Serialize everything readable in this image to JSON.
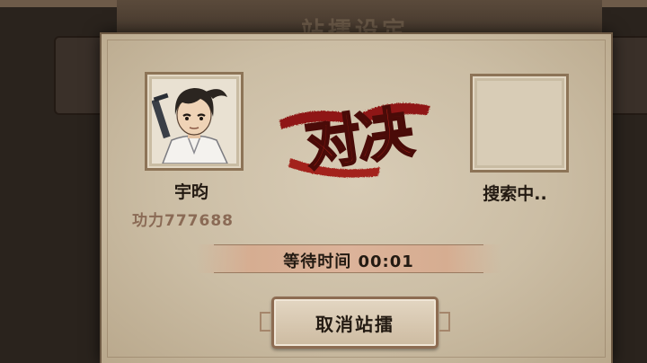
{
  "background": {
    "title": "站擂设定"
  },
  "player": {
    "name": "宇昀",
    "power": "功力777688",
    "avatar": "swordsman-avatar"
  },
  "opponent": {
    "name": "搜索中.."
  },
  "versus_label": "对决",
  "timer": {
    "text": "等待时间 00:01"
  },
  "cancel_button": {
    "label": "取消站擂"
  },
  "colors": {
    "parchment": "#cbbda4",
    "frame": "#8d7457",
    "versus_red": "#b8251a",
    "power_text": "#8a6a55"
  }
}
